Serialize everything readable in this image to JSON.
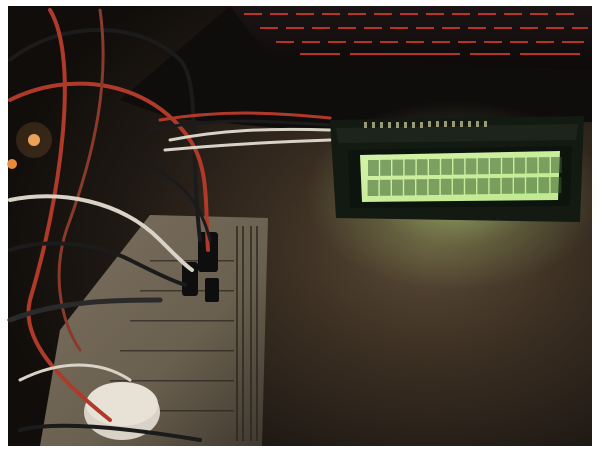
{
  "photo": {
    "subject": "",
    "colors": {
      "frame": "#ffffff",
      "ambient_dark": "#0c0a08",
      "table_warm": "#4a3a28",
      "lcd_backlight": "#d8f6b0",
      "lcd_glow": "#b8e07a",
      "lcd_pixel": "#3b5f2f",
      "keyboard_red": "#d33a2a",
      "breadboard": "#b9aa90",
      "wire_red": "#b03a2a",
      "wire_white": "#d9d3c7",
      "wire_black": "#1b1b1b"
    },
    "lcd": {
      "rows": 2,
      "columns": 16
    }
  }
}
